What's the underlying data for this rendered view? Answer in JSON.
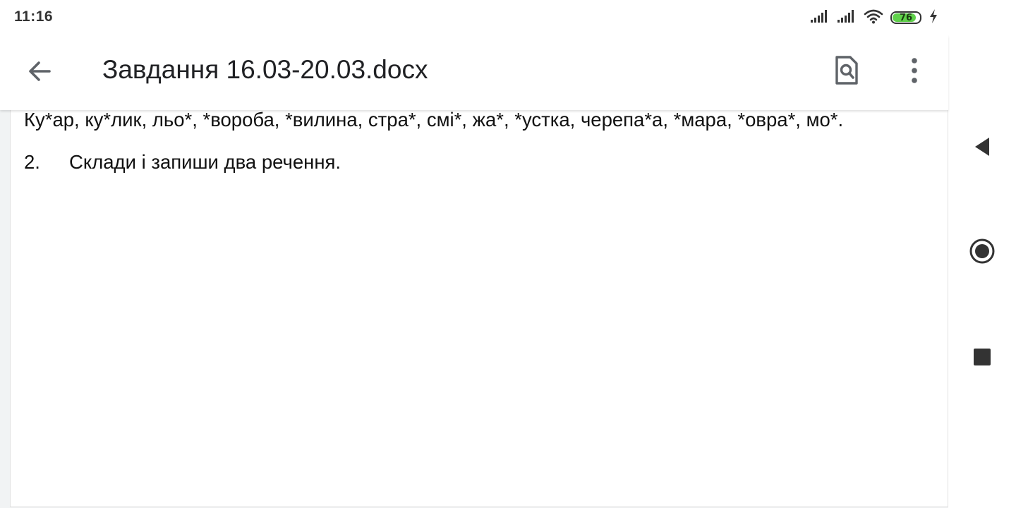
{
  "status_bar": {
    "time": "11:16",
    "battery_level": "76",
    "icons": [
      "signal-sim1-icon",
      "signal-sim2-icon",
      "wifi-icon",
      "battery-icon",
      "charging-icon"
    ],
    "battery_color": "#5fd14a"
  },
  "app_bar": {
    "title": "Завдання 16.03-20.03.docx",
    "back_icon": "arrow-back-icon",
    "find_icon": "find-in-page-icon",
    "more_icon": "more-vert-icon"
  },
  "document": {
    "line1": "Ку*ар, ку*лик, льо*, *вороба, *вилина, стра*, смі*, жа*, *устка, черепа*а, *мара, *овра*, мо*.",
    "item2_number": "2.",
    "item2_text": "Склади і запиши два речення."
  },
  "nav_bar": {
    "icons": [
      "back-triangle-icon",
      "home-circle-icon",
      "recents-square-icon"
    ]
  }
}
